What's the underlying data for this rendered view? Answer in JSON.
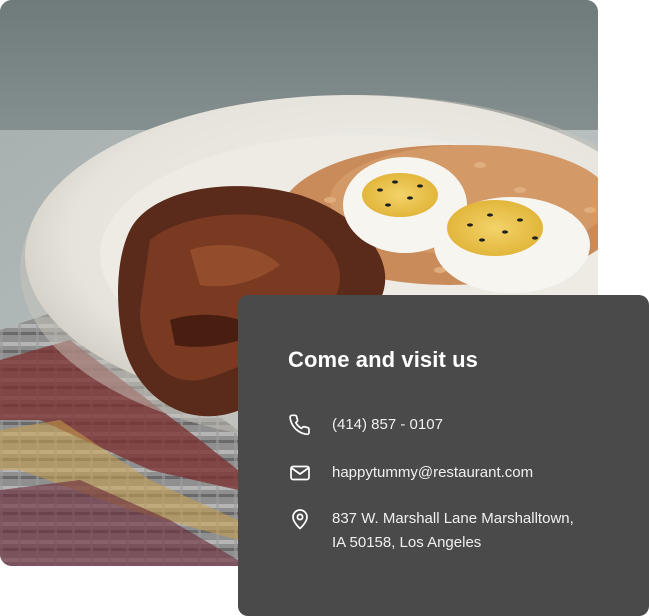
{
  "photo": {
    "alt_icon": "food-photo"
  },
  "contact": {
    "title": "Come and visit us",
    "phone": "(414) 857 - 0107",
    "email": "happytummy@restaurant.com",
    "address_line1": "837 W. Marshall Lane Marshalltown,",
    "address_line2": "IA 50158, Los Angeles",
    "icons": {
      "phone": "phone-icon",
      "email": "mail-icon",
      "address": "map-pin-icon"
    },
    "colors": {
      "card_bg": "#4a4a4a",
      "text": "#ffffff"
    }
  }
}
